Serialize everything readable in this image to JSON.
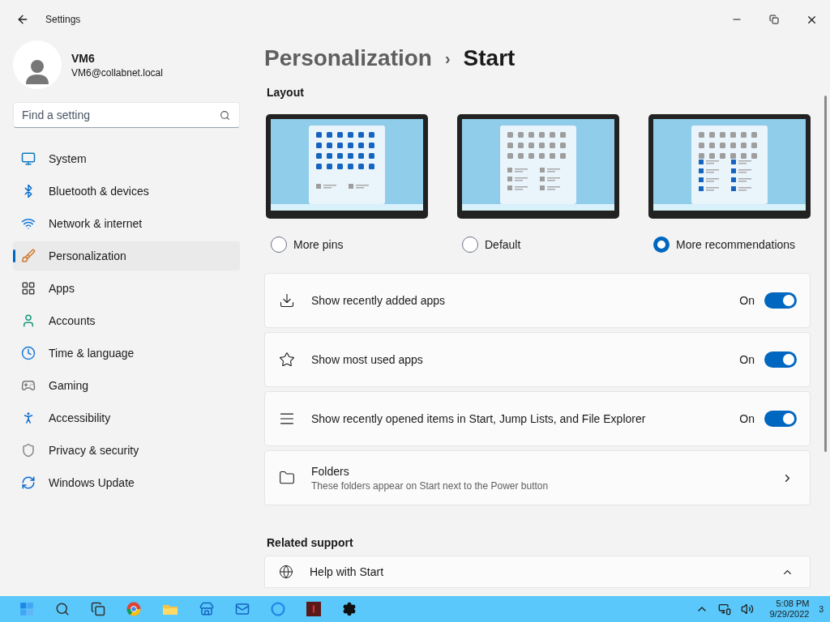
{
  "window": {
    "title": "Settings"
  },
  "user": {
    "name": "VM6",
    "email": "VM6@collabnet.local"
  },
  "search": {
    "placeholder": "Find a setting"
  },
  "sidebar": {
    "items": [
      {
        "label": "System",
        "selected": false
      },
      {
        "label": "Bluetooth & devices",
        "selected": false
      },
      {
        "label": "Network & internet",
        "selected": false
      },
      {
        "label": "Personalization",
        "selected": true
      },
      {
        "label": "Apps",
        "selected": false
      },
      {
        "label": "Accounts",
        "selected": false
      },
      {
        "label": "Time & language",
        "selected": false
      },
      {
        "label": "Gaming",
        "selected": false
      },
      {
        "label": "Accessibility",
        "selected": false
      },
      {
        "label": "Privacy & security",
        "selected": false
      },
      {
        "label": "Windows Update",
        "selected": false
      }
    ]
  },
  "breadcrumb": {
    "parent": "Personalization",
    "separator": "›",
    "current": "Start"
  },
  "layout": {
    "heading": "Layout",
    "options": [
      {
        "label": "More pins",
        "kind": "pins",
        "selected": false
      },
      {
        "label": "Default",
        "kind": "default",
        "selected": false
      },
      {
        "label": "More recommendations",
        "kind": "recs",
        "selected": true
      }
    ]
  },
  "settings": [
    {
      "kind": "toggle",
      "label": "Show recently added apps",
      "state_text": "On",
      "on": true
    },
    {
      "kind": "toggle",
      "label": "Show most used apps",
      "state_text": "On",
      "on": true
    },
    {
      "kind": "toggle",
      "label": "Show recently opened items in Start, Jump Lists, and File Explorer",
      "state_text": "On",
      "on": true
    },
    {
      "kind": "link",
      "label": "Folders",
      "description": "These folders appear on Start next to the Power button"
    }
  ],
  "related": {
    "heading": "Related support",
    "items": [
      {
        "label": "Help with Start",
        "expanded": true
      }
    ]
  },
  "taskbar": {
    "time": "5:08 PM",
    "date": "9/29/2022",
    "notifications": "3"
  }
}
